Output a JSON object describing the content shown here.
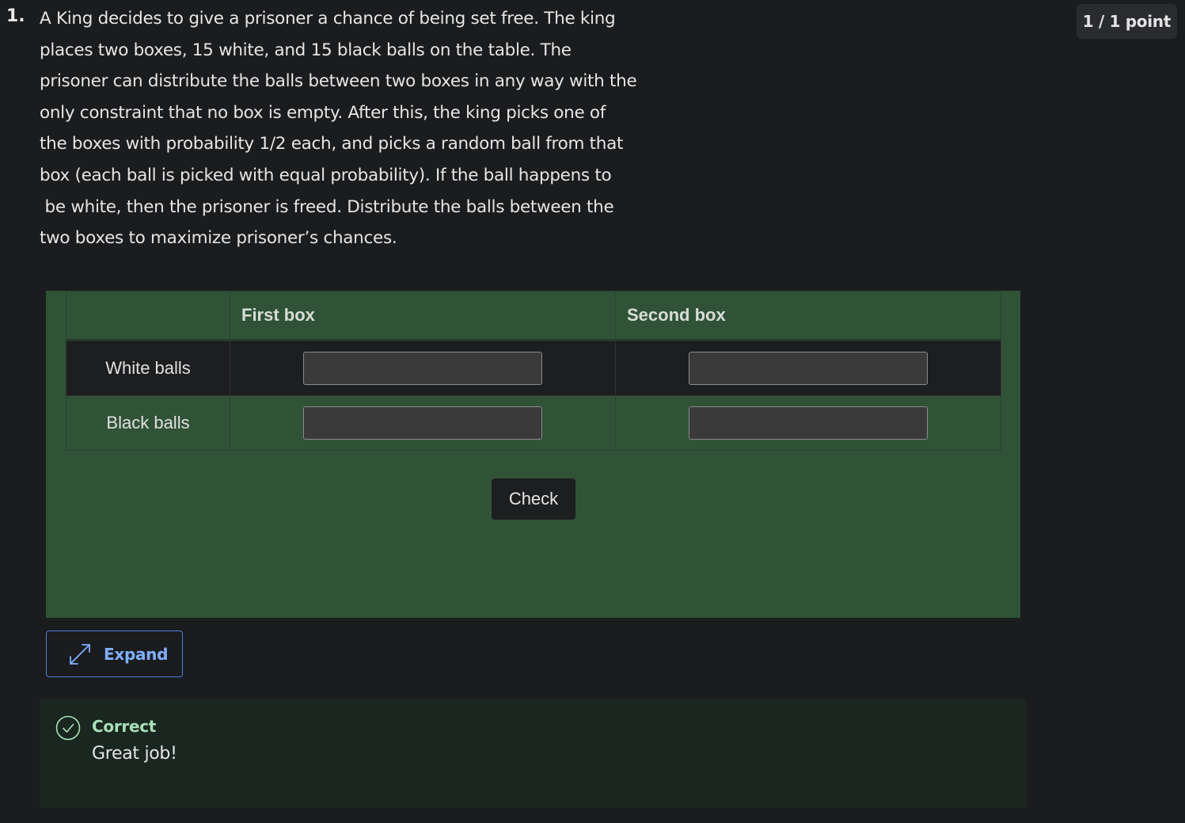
{
  "question": {
    "number": "1.",
    "lines": [
      "A King decides to give a prisoner a chance of being set free. The king",
      "places two boxes, 15 white, and 15 black balls on the table. The",
      "prisoner can distribute the balls between two boxes in any way with the",
      "only constraint that no box is empty. After this, the king picks one of",
      "the boxes with probability 1/2 each, and picks a random ball from that",
      "box (each ball is picked with equal probability). If the ball happens to",
      " be white, then the prisoner is freed. Distribute the balls between the",
      "two boxes to maximize prisoner’s chances."
    ],
    "points": "1 / 1 point"
  },
  "table": {
    "headers": [
      "",
      "First box",
      "Second box"
    ],
    "rows": [
      {
        "label": "White balls",
        "first_value": "",
        "second_value": ""
      },
      {
        "label": "Black balls",
        "first_value": "",
        "second_value": ""
      }
    ]
  },
  "buttons": {
    "check_label": "Check",
    "expand_label": "Expand"
  },
  "feedback": {
    "status": "Correct",
    "message": "Great job!"
  },
  "icons": {
    "expand": "expand-arrows-icon",
    "correct": "check-circle-icon"
  },
  "colors": {
    "widget_bg": "#305338",
    "accent": "#4a7fe0",
    "correct": "#a6e0b8"
  }
}
